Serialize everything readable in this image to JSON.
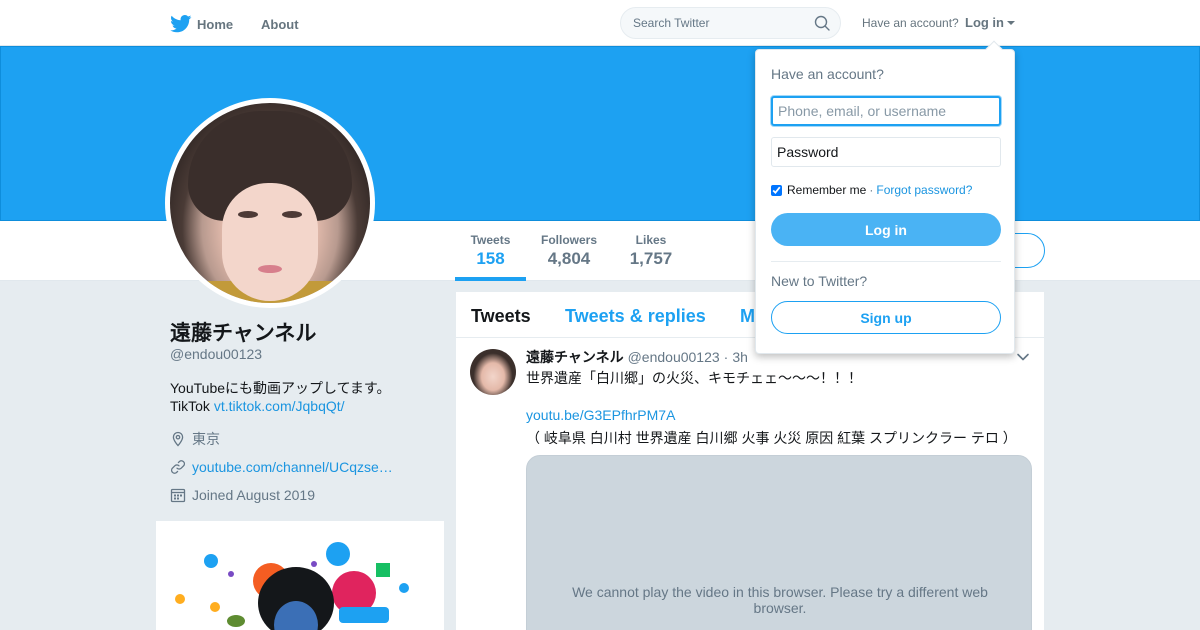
{
  "nav": {
    "home_label": "Home",
    "about_label": "About",
    "search_placeholder": "Search Twitter",
    "have_account": "Have an account?",
    "login_label": "Log in",
    "logo_icon": "twitter-bird-icon",
    "search_icon": "search-icon"
  },
  "colors": {
    "brand": "#1da1f2",
    "link": "#1b95e0",
    "login_button": "#4ab3f4",
    "page_background": "#e6ecf0"
  },
  "stats": [
    {
      "label": "Tweets",
      "value": "158"
    },
    {
      "label": "Followers",
      "value": "4,804"
    },
    {
      "label": "Likes",
      "value": "1,757"
    }
  ],
  "profile": {
    "name": "遠藤チャンネル",
    "handle": "@endou00123",
    "bio_line1": "YouTubeにも動画アップしてます。",
    "bio_tiktok_prefix": "TikTok ",
    "bio_tiktok_link": "vt.tiktok.com/JqbqQt/",
    "location": "東京",
    "website": "youtube.com/channel/UCqzse…",
    "joined": "Joined August 2019",
    "location_icon": "location-pin-icon",
    "link_icon": "link-icon",
    "calendar_icon": "calendar-icon"
  },
  "timeline": {
    "tabs": [
      "Tweets",
      "Tweets & replies",
      "M"
    ],
    "tweet": {
      "name": "遠藤チャンネル",
      "handle": "@endou00123",
      "dot": "·",
      "time": "3h",
      "line1": "世界遺産「白川郷」の火災、キモチェェ〜〜〜！！！",
      "link": "youtu.be/G3EPfhrPM7A",
      "line3": "（ 岐阜県 白川村 世界遺産 白川郷 火事 火災 原因 紅葉 スプリンクラー テロ ）",
      "video_message": "We cannot play the video in this browser. Please try a different web browser."
    }
  },
  "login_dropdown": {
    "title": "Have an account?",
    "username_placeholder": "Phone, email, or username",
    "password_placeholder": "Password",
    "remember_label": "Remember me",
    "separator": "·",
    "forgot_label": "Forgot password?",
    "login_button": "Log in",
    "new_label": "New to Twitter?",
    "signup_button": "Sign up"
  }
}
